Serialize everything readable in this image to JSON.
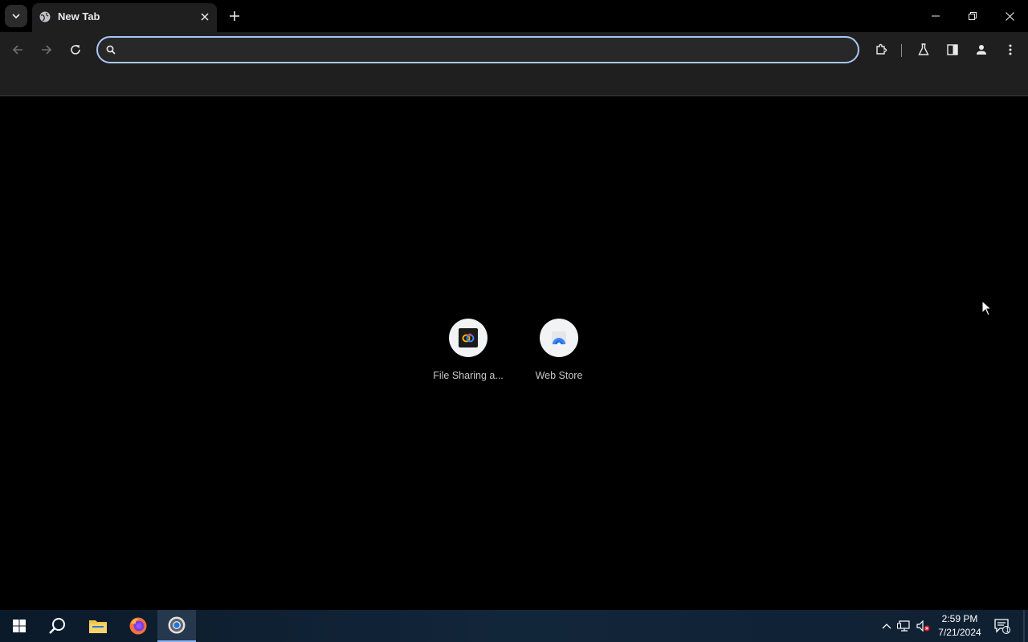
{
  "tab": {
    "title": "New Tab"
  },
  "omnibox": {
    "value": "",
    "placeholder": ""
  },
  "shortcuts": [
    {
      "label": "File Sharing a..."
    },
    {
      "label": "Web Store"
    }
  ],
  "taskbar": {
    "time": "2:59 PM",
    "date": "7/21/2024",
    "notification_count": "1"
  },
  "colors": {
    "accent": "#a8c7fa",
    "toolbar_bg": "#1f1f1f",
    "page_bg": "#000000"
  }
}
